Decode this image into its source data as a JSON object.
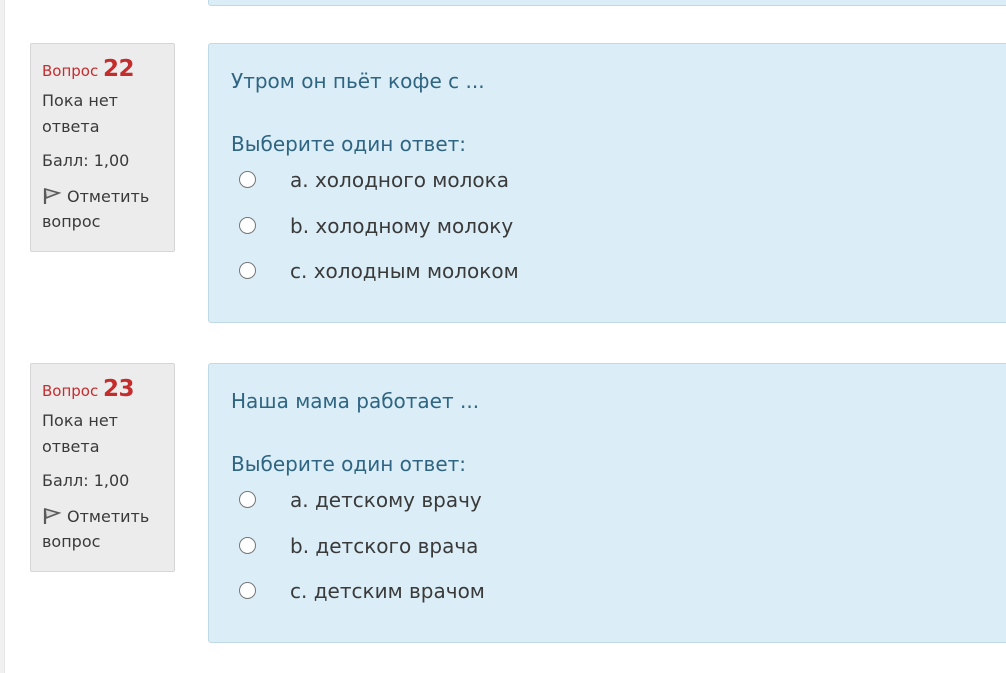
{
  "questions": [
    {
      "label": "Вопрос",
      "number": "22",
      "state": "Пока нет ответа",
      "grade": "Балл: 1,00",
      "flag_label": "Отметить вопрос",
      "text": "Утром он пьёт кофе с ...",
      "prompt": "Выберите один ответ:",
      "answers": [
        {
          "label": "a. холодного молока",
          "checked": false
        },
        {
          "label": "b. холодному молоку",
          "checked": false
        },
        {
          "label": "c. холодным молоком",
          "checked": false
        }
      ]
    },
    {
      "label": "Вопрос",
      "number": "23",
      "state": "Пока нет ответа",
      "grade": "Балл: 1,00",
      "flag_label": "Отметить вопрос",
      "text": "Наша мама работает ...",
      "prompt": "Выберите один ответ:",
      "answers": [
        {
          "label": "a. детскому врачу",
          "checked": false
        },
        {
          "label": "b. детского врача",
          "checked": false
        },
        {
          "label": "c. детским врачом",
          "checked": false
        }
      ]
    }
  ],
  "colors": {
    "question_number": "#c52d2d",
    "content_bg": "#dbedf6",
    "info_bg": "#ececed",
    "question_text": "#2f6582"
  },
  "icons": {
    "flag": "flag-icon"
  }
}
